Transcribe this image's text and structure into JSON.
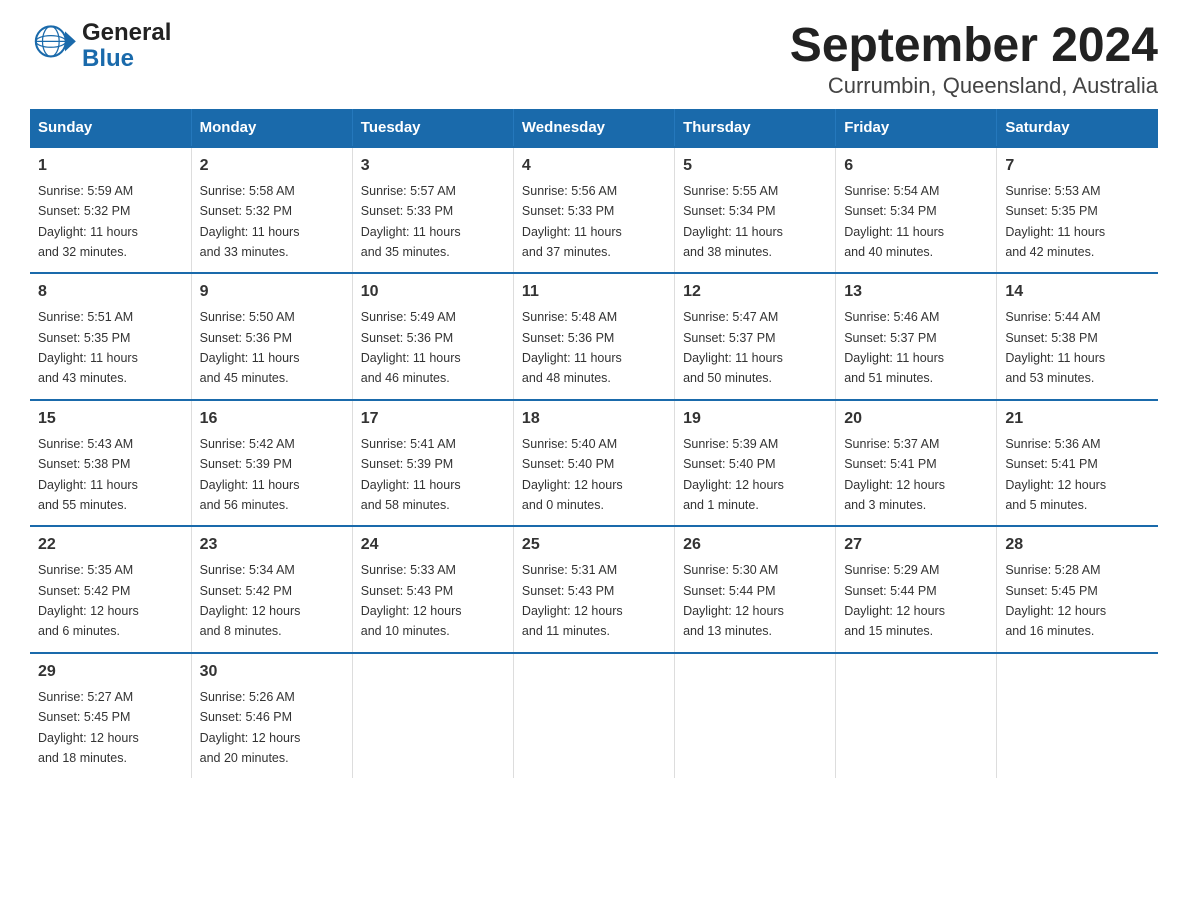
{
  "header": {
    "title": "September 2024",
    "subtitle": "Currumbin, Queensland, Australia"
  },
  "logo": {
    "general": "General",
    "blue": "Blue"
  },
  "days_header": [
    "Sunday",
    "Monday",
    "Tuesday",
    "Wednesday",
    "Thursday",
    "Friday",
    "Saturday"
  ],
  "weeks": [
    [
      {
        "day": "1",
        "sunrise": "5:59 AM",
        "sunset": "5:32 PM",
        "daylight": "11 hours and 32 minutes."
      },
      {
        "day": "2",
        "sunrise": "5:58 AM",
        "sunset": "5:32 PM",
        "daylight": "11 hours and 33 minutes."
      },
      {
        "day": "3",
        "sunrise": "5:57 AM",
        "sunset": "5:33 PM",
        "daylight": "11 hours and 35 minutes."
      },
      {
        "day": "4",
        "sunrise": "5:56 AM",
        "sunset": "5:33 PM",
        "daylight": "11 hours and 37 minutes."
      },
      {
        "day": "5",
        "sunrise": "5:55 AM",
        "sunset": "5:34 PM",
        "daylight": "11 hours and 38 minutes."
      },
      {
        "day": "6",
        "sunrise": "5:54 AM",
        "sunset": "5:34 PM",
        "daylight": "11 hours and 40 minutes."
      },
      {
        "day": "7",
        "sunrise": "5:53 AM",
        "sunset": "5:35 PM",
        "daylight": "11 hours and 42 minutes."
      }
    ],
    [
      {
        "day": "8",
        "sunrise": "5:51 AM",
        "sunset": "5:35 PM",
        "daylight": "11 hours and 43 minutes."
      },
      {
        "day": "9",
        "sunrise": "5:50 AM",
        "sunset": "5:36 PM",
        "daylight": "11 hours and 45 minutes."
      },
      {
        "day": "10",
        "sunrise": "5:49 AM",
        "sunset": "5:36 PM",
        "daylight": "11 hours and 46 minutes."
      },
      {
        "day": "11",
        "sunrise": "5:48 AM",
        "sunset": "5:36 PM",
        "daylight": "11 hours and 48 minutes."
      },
      {
        "day": "12",
        "sunrise": "5:47 AM",
        "sunset": "5:37 PM",
        "daylight": "11 hours and 50 minutes."
      },
      {
        "day": "13",
        "sunrise": "5:46 AM",
        "sunset": "5:37 PM",
        "daylight": "11 hours and 51 minutes."
      },
      {
        "day": "14",
        "sunrise": "5:44 AM",
        "sunset": "5:38 PM",
        "daylight": "11 hours and 53 minutes."
      }
    ],
    [
      {
        "day": "15",
        "sunrise": "5:43 AM",
        "sunset": "5:38 PM",
        "daylight": "11 hours and 55 minutes."
      },
      {
        "day": "16",
        "sunrise": "5:42 AM",
        "sunset": "5:39 PM",
        "daylight": "11 hours and 56 minutes."
      },
      {
        "day": "17",
        "sunrise": "5:41 AM",
        "sunset": "5:39 PM",
        "daylight": "11 hours and 58 minutes."
      },
      {
        "day": "18",
        "sunrise": "5:40 AM",
        "sunset": "5:40 PM",
        "daylight": "12 hours and 0 minutes."
      },
      {
        "day": "19",
        "sunrise": "5:39 AM",
        "sunset": "5:40 PM",
        "daylight": "12 hours and 1 minute."
      },
      {
        "day": "20",
        "sunrise": "5:37 AM",
        "sunset": "5:41 PM",
        "daylight": "12 hours and 3 minutes."
      },
      {
        "day": "21",
        "sunrise": "5:36 AM",
        "sunset": "5:41 PM",
        "daylight": "12 hours and 5 minutes."
      }
    ],
    [
      {
        "day": "22",
        "sunrise": "5:35 AM",
        "sunset": "5:42 PM",
        "daylight": "12 hours and 6 minutes."
      },
      {
        "day": "23",
        "sunrise": "5:34 AM",
        "sunset": "5:42 PM",
        "daylight": "12 hours and 8 minutes."
      },
      {
        "day": "24",
        "sunrise": "5:33 AM",
        "sunset": "5:43 PM",
        "daylight": "12 hours and 10 minutes."
      },
      {
        "day": "25",
        "sunrise": "5:31 AM",
        "sunset": "5:43 PM",
        "daylight": "12 hours and 11 minutes."
      },
      {
        "day": "26",
        "sunrise": "5:30 AM",
        "sunset": "5:44 PM",
        "daylight": "12 hours and 13 minutes."
      },
      {
        "day": "27",
        "sunrise": "5:29 AM",
        "sunset": "5:44 PM",
        "daylight": "12 hours and 15 minutes."
      },
      {
        "day": "28",
        "sunrise": "5:28 AM",
        "sunset": "5:45 PM",
        "daylight": "12 hours and 16 minutes."
      }
    ],
    [
      {
        "day": "29",
        "sunrise": "5:27 AM",
        "sunset": "5:45 PM",
        "daylight": "12 hours and 18 minutes."
      },
      {
        "day": "30",
        "sunrise": "5:26 AM",
        "sunset": "5:46 PM",
        "daylight": "12 hours and 20 minutes."
      },
      null,
      null,
      null,
      null,
      null
    ]
  ],
  "labels": {
    "sunrise": "Sunrise:",
    "sunset": "Sunset:",
    "daylight": "Daylight:"
  }
}
